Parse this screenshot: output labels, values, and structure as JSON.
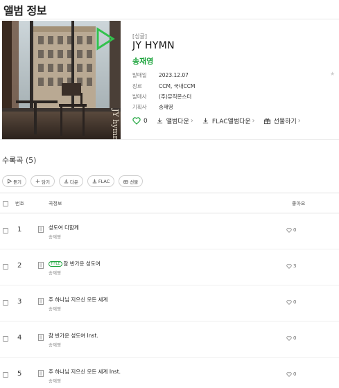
{
  "page": {
    "title": "앨범 정보"
  },
  "album": {
    "type": "[싱글]",
    "title": "JY HYMN",
    "artist": "송재영",
    "meta": [
      {
        "label": "발매일",
        "value": "2023.12.07"
      },
      {
        "label": "장르",
        "value": "CCM, 국내CCM"
      },
      {
        "label": "발매사",
        "value": "(주)뮤직몬스터"
      },
      {
        "label": "기획사",
        "value": "송재영"
      }
    ],
    "likes": "0",
    "actions": {
      "album_download": "앨범다운",
      "flac_download": "FLAC앨범다운",
      "gift": "선물하기"
    }
  },
  "tracklist": {
    "heading": "수록곡",
    "count": "(5)",
    "buttons": {
      "play": "듣기",
      "add": "담기",
      "download": "다운",
      "flac": "FLAC",
      "gift": "선물"
    },
    "headers": {
      "no": "번호",
      "info": "곡정보",
      "like": "좋아요"
    },
    "title_badge": "TITLE",
    "tracks": [
      {
        "no": "1",
        "title": "성도여 다함께",
        "artist": "송재영",
        "likes": "0",
        "is_title": false
      },
      {
        "no": "2",
        "title": "참 반가운 성도여",
        "artist": "송재영",
        "likes": "3",
        "is_title": true
      },
      {
        "no": "3",
        "title": "주 하나님 지으신 모든 세계",
        "artist": "송재영",
        "likes": "0",
        "is_title": false
      },
      {
        "no": "4",
        "title": "참 반가운 성도여 Inst.",
        "artist": "송재영",
        "likes": "0",
        "is_title": false
      },
      {
        "no": "5",
        "title": "주 하나님 지으신 모든 세계 Inst.",
        "artist": "송재영",
        "likes": "0",
        "is_title": false
      }
    ]
  },
  "colors": {
    "accent": "#1aa33a",
    "divider": "#e6e6e6"
  },
  "cover": {
    "overlay_text": "JY hymn"
  }
}
